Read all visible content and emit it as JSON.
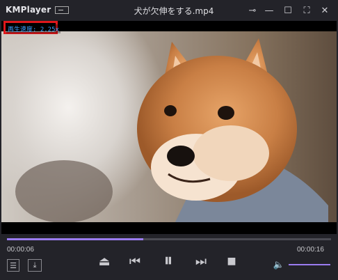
{
  "app": {
    "name": "KMPlayer",
    "file_title": "犬が欠伸をする.mp4"
  },
  "window_buttons": [
    {
      "name": "pin-icon",
      "glyph": "⊸"
    },
    {
      "name": "minimize-icon",
      "glyph": "—"
    },
    {
      "name": "maximize-icon",
      "glyph": "☐"
    },
    {
      "name": "fullscreen-icon",
      "glyph": "⛶"
    },
    {
      "name": "close-icon",
      "glyph": "✕"
    }
  ],
  "overlay": {
    "speed_text": "再生速度: 2.25x"
  },
  "playback": {
    "elapsed": "00:00:06",
    "total": "00:00:16",
    "progress_fraction": 0.42
  },
  "controls": {
    "eject_glyph": "⏏",
    "prev_glyph": "⏮",
    "pause_glyph": "⏸",
    "next_glyph": "⏭",
    "stop_glyph": "■",
    "playlist_glyph": "☰",
    "open_glyph": "⤓",
    "volume_glyph": "🔈"
  },
  "colors": {
    "accent": "#9b7cf0",
    "speed_text": "#3aa0ff",
    "highlight_box": "#e0171b"
  }
}
